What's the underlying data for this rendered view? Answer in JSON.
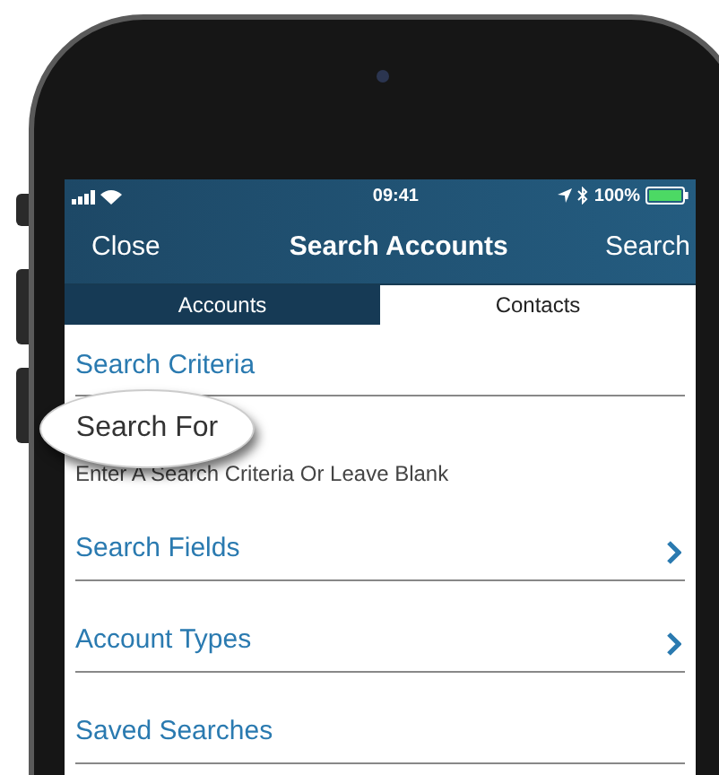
{
  "status_bar": {
    "time": "09:41",
    "battery": "100%"
  },
  "nav_bar": {
    "left": "Close",
    "title": "Search Accounts",
    "right": "Search"
  },
  "tabs": [
    {
      "label": "Accounts",
      "selected": true
    },
    {
      "label": "Contacts",
      "selected": false
    }
  ],
  "rows": [
    {
      "kind": "section",
      "label": "Search Criteria"
    },
    {
      "kind": "field",
      "label": "Search For",
      "placeholder": "Enter A Search Criteria Or Leave Blank"
    },
    {
      "kind": "link",
      "label": "Search Fields",
      "chevron": true
    },
    {
      "kind": "link",
      "label": "Account Types",
      "chevron": true
    },
    {
      "kind": "link",
      "label": "Saved Searches",
      "chevron": false
    }
  ]
}
